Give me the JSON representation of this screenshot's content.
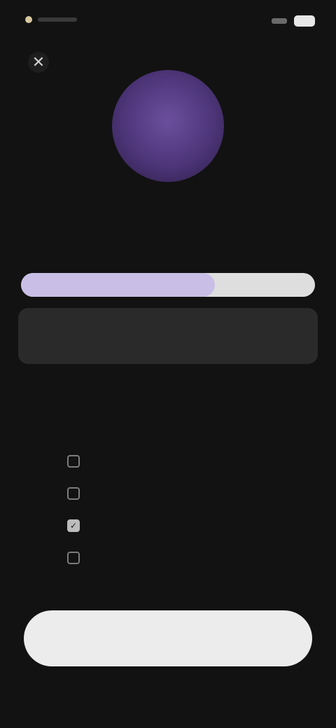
{
  "status_bar": {
    "signal_icon": "signal-icon",
    "battery_icon": "battery-icon"
  },
  "close_icon": "close-icon",
  "close_glyph": "✕",
  "avatar": {
    "initials": "",
    "colors": {
      "center": "#6b4f9e",
      "edge": "#2a1c45"
    }
  },
  "title": "",
  "progress": {
    "fraction": 0.66,
    "fill_color": "#c9bfe6",
    "track_color": "#dedede"
  },
  "task_card": {
    "title": "",
    "subtitle": "",
    "action": ""
  },
  "summary_row": {
    "left": "",
    "right": ""
  },
  "features": [
    {
      "label": "",
      "checked": false
    },
    {
      "label": "",
      "checked": false
    },
    {
      "label": "",
      "checked": true
    },
    {
      "label": "",
      "checked": false
    }
  ],
  "primary_button": {
    "label": ""
  },
  "secondary_link": {
    "label": ""
  },
  "colors": {
    "background": "#121212",
    "primary_button": "#ececec"
  }
}
